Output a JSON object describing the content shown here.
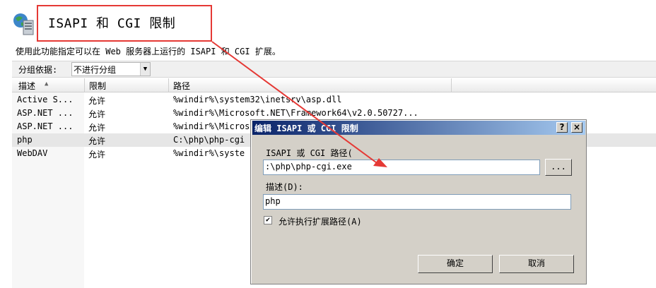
{
  "page": {
    "title": "ISAPI 和 CGI 限制",
    "description": "使用此功能指定可以在 Web 服务器上运行的 ISAPI 和 CGI 扩展。"
  },
  "grouping": {
    "label": "分组依据:",
    "selected": "不进行分组"
  },
  "table": {
    "columns": [
      "描述",
      "限制",
      "路径"
    ],
    "rows": [
      {
        "desc": "Active S...",
        "restriction": "允许",
        "path": "%windir%\\system32\\inetsrv\\asp.dll"
      },
      {
        "desc": "ASP.NET ...",
        "restriction": "允许",
        "path": "%windir%\\Microsoft.NET\\Framework64\\v2.0.50727..."
      },
      {
        "desc": "ASP.NET ...",
        "restriction": "允许",
        "path": "%windir%\\Micros"
      },
      {
        "desc": "php",
        "restriction": "允许",
        "path": "C:\\php\\php-cgi"
      },
      {
        "desc": "WebDAV",
        "restriction": "允许",
        "path": "%windir%\\syste"
      }
    ],
    "selected_row_index": 3
  },
  "dialog": {
    "title": "编辑 ISAPI 或 CGI 限制",
    "help_button": "?",
    "close_button": "×",
    "path_label": "ISAPI 或 CGI 路径(",
    "path_value": ":\\php\\php-cgi.exe",
    "browse_label": "...",
    "desc_label": "描述(D):",
    "desc_value": "php",
    "checkbox_checked": true,
    "checkbox_label": "允许执行扩展路径(A)",
    "ok_label": "确定",
    "cancel_label": "取消"
  },
  "colors": {
    "annotation": "#e53935",
    "title_bar_start": "#0a246a",
    "title_bar_end": "#a6caf0"
  }
}
